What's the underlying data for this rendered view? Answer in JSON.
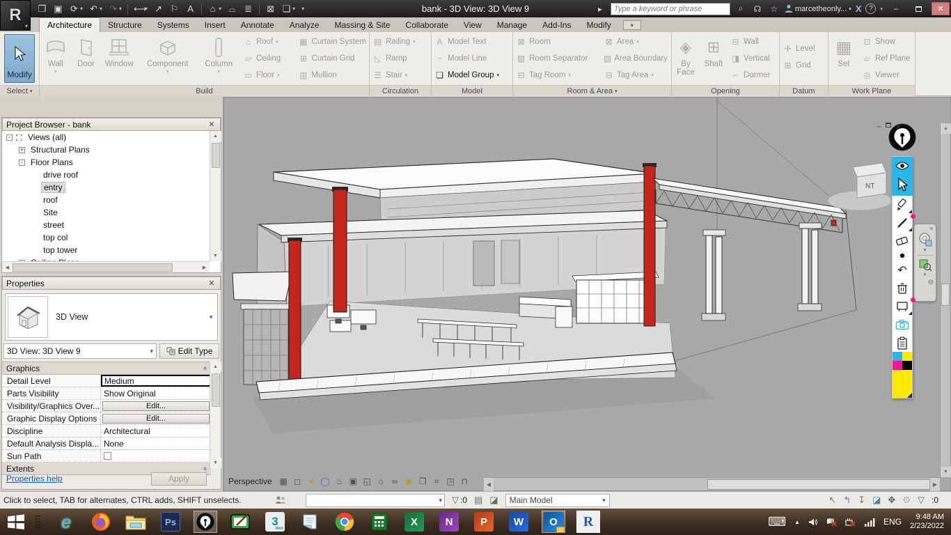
{
  "ui": {
    "caret": "▾",
    "caret_right": "▸",
    "up": "▲",
    "down": "▼",
    "left": "◀",
    "right": "▶",
    "minimize": "–",
    "close": "✕",
    "collapse": "-",
    "expand": "+",
    "section_pin": "«",
    "ellipsis_x": "✕"
  },
  "title_bar": {
    "title": "bank - 3D View: 3D View 9",
    "search_placeholder": "Type a keyword or phrase",
    "account_name": "marcetheonly...",
    "exchange_label": "X",
    "help_label": "?",
    "qat": [
      {
        "name": "open-file-icon",
        "glyph": "❒"
      },
      {
        "name": "save-icon",
        "glyph": "▣"
      },
      {
        "name": "sync-with-central-icon",
        "glyph": "⟳"
      },
      {
        "name": "undo-icon",
        "glyph": "↶"
      },
      {
        "name": "redo-icon",
        "glyph": "↷"
      },
      {
        "name": "measure-icon",
        "glyph": "⟷"
      },
      {
        "name": "aligned-dimension-icon",
        "glyph": "↗"
      },
      {
        "name": "tag-by-category-icon",
        "glyph": "⚐"
      },
      {
        "name": "text-icon",
        "glyph": "A"
      },
      {
        "name": "default-3d-view-icon",
        "glyph": "⌂"
      },
      {
        "name": "section-icon",
        "glyph": "⌓"
      },
      {
        "name": "thin-lines-icon",
        "glyph": "≣"
      },
      {
        "name": "close-hidden-windows-icon",
        "glyph": "⊠"
      },
      {
        "name": "switch-windows-icon",
        "glyph": "❏"
      }
    ]
  },
  "ribbon": {
    "tabs": [
      "Architecture",
      "Structure",
      "Systems",
      "Insert",
      "Annotate",
      "Analyze",
      "Massing & Site",
      "Collaborate",
      "View",
      "Manage",
      "Add-Ins",
      "Modify"
    ],
    "panels": [
      {
        "label": "Select",
        "items": [
          "Modify"
        ]
      },
      {
        "label": "Build",
        "items": [
          "Wall",
          "Door",
          "Window",
          "Component",
          "Column",
          "Roof",
          "Ceiling",
          "Floor",
          "Curtain System",
          "Curtain Grid",
          "Mullion"
        ]
      },
      {
        "label": "Circulation",
        "items": [
          "Railing",
          "Ramp",
          "Stair"
        ]
      },
      {
        "label": "Model",
        "items": [
          "Model Text",
          "Model Line",
          "Model Group"
        ]
      },
      {
        "label": "Room & Area",
        "items": [
          "Room",
          "Room Separator",
          "Tag Room",
          "Area",
          "Area Boundary",
          "Tag Area"
        ]
      },
      {
        "label": "Opening",
        "items": [
          "By Face",
          "Shaft",
          "Wall",
          "Vertical",
          "Dormer"
        ]
      },
      {
        "label": "Datum",
        "items": [
          "Level",
          "Grid"
        ]
      },
      {
        "label": "Work Plane",
        "items": [
          "Set",
          "Show",
          "Ref Plane",
          "Viewer"
        ]
      }
    ],
    "small_icons": {
      "roof": "⌂",
      "ceiling": "▱",
      "floor": "▭",
      "curtain_system": "▦",
      "curtain_grid": "⊞",
      "mullion": "▥",
      "railing": "▤",
      "ramp": "◺",
      "stair": "☰",
      "model_text": "A",
      "model_line": "~",
      "model_group": "❏",
      "room": "⊠",
      "room_separator": "▨",
      "tag_room": "⊟",
      "area": "⊠",
      "area_boundary": "▧",
      "tag_area": "⊟",
      "wall_opening": "⊟",
      "vertical_opening": "◨",
      "dormer": "⌐",
      "level": "✛",
      "grid": "⊞",
      "show": "⊡",
      "ref_plane": "▱",
      "viewer": "◎",
      "by_face": "◈",
      "shaft": "⊞",
      "set": "▦"
    }
  },
  "project_browser": {
    "title": "Project Browser - bank",
    "items": [
      {
        "label": "Views (all)"
      },
      {
        "label": "Structural Plans"
      },
      {
        "label": "Floor Plans"
      },
      {
        "label": "drive roof"
      },
      {
        "label": "entry"
      },
      {
        "label": "roof"
      },
      {
        "label": "Site"
      },
      {
        "label": "street"
      },
      {
        "label": "top col"
      },
      {
        "label": "top tower"
      },
      {
        "label": "Ceiling Plans"
      }
    ]
  },
  "properties": {
    "title": "Properties",
    "type_name": "3D View",
    "selector_value": "3D View: 3D View 9",
    "edit_type_label": "Edit Type",
    "section_graphics": "Graphics",
    "section_extents": "Extents",
    "rows": [
      {
        "label": "Detail Level",
        "value": "Medium"
      },
      {
        "label": "Parts Visibility",
        "value": "Show Original"
      },
      {
        "label": "Visibility/Graphics Over...",
        "value": "Edit..."
      },
      {
        "label": "Graphic Display Options",
        "value": "Edit..."
      },
      {
        "label": "Discipline",
        "value": "Architectural"
      },
      {
        "label": "Default Analysis Displa...",
        "value": "None"
      },
      {
        "label": "Sun Path",
        "value": ""
      }
    ],
    "help_link": "Properties help",
    "apply_label": "Apply"
  },
  "viewport": {
    "perspective_label": "Perspective",
    "view_cube_text": "NT",
    "vcb_icons": [
      {
        "name": "detail-level-icon",
        "glyph": "▦"
      },
      {
        "name": "visual-style-icon",
        "glyph": "◻"
      },
      {
        "name": "sun-path-icon",
        "glyph": "☀"
      },
      {
        "name": "shadows-icon",
        "glyph": "◯"
      },
      {
        "name": "rendering-dialog-icon",
        "glyph": "♨"
      },
      {
        "name": "crop-view-icon",
        "glyph": "▣"
      },
      {
        "name": "show-crop-region-icon",
        "glyph": "◱"
      },
      {
        "name": "lock-3d-view-icon",
        "glyph": "⌂"
      },
      {
        "name": "temporary-hide-isolate-icon",
        "glyph": "∞"
      },
      {
        "name": "reveal-hidden-elements-icon",
        "glyph": "◉"
      },
      {
        "name": "temporary-view-properties-icon",
        "glyph": "❒"
      },
      {
        "name": "show-analytical-model-icon",
        "glyph": "⌗"
      },
      {
        "name": "highlight-displacement-sets-icon",
        "glyph": "◳"
      },
      {
        "name": "reveal-constraints-icon",
        "glyph": "⊓"
      }
    ]
  },
  "status_bar": {
    "hint": "Click to select, TAB for alternates, CTRL adds, SHIFT unselects.",
    "workset_filter_count": ":0",
    "design_option": "Main Model",
    "selection_count": ":0",
    "right_icons": [
      {
        "name": "select-links-icon",
        "glyph": "↖"
      },
      {
        "name": "select-underlay-elements-icon",
        "glyph": "↰"
      },
      {
        "name": "select-pinned-elements-icon",
        "glyph": "↧"
      },
      {
        "name": "select-elements-by-face-icon",
        "glyph": "◪"
      },
      {
        "name": "drag-elements-on-selection-icon",
        "glyph": "✥"
      },
      {
        "name": "gear-icon",
        "glyph": "⚙"
      },
      {
        "name": "selection-filter-icon",
        "glyph": "▽"
      }
    ]
  },
  "taskbar": {
    "apps": [
      {
        "name": "internet-explorer",
        "glyph": "e"
      },
      {
        "name": "photoshop",
        "glyph": "Ps"
      },
      {
        "name": "3ds-max",
        "glyph": "3"
      },
      {
        "name": "3ds-max-sub",
        "glyph": "MAX"
      },
      {
        "name": "excel",
        "glyph": "X"
      },
      {
        "name": "onenote",
        "glyph": "N"
      },
      {
        "name": "powerpoint",
        "glyph": "P"
      },
      {
        "name": "word",
        "glyph": "W"
      },
      {
        "name": "outlook",
        "glyph": "O"
      },
      {
        "name": "revit",
        "glyph": "R"
      }
    ],
    "tray": {
      "language": "ENG",
      "time": "9:48 AM",
      "date": "2/23/2022"
    }
  },
  "colors": {
    "selection_accent_blue": "#7fa9cb",
    "section_cut_red": "#c5271c",
    "viewport_background": "#a6a8aa",
    "epic_pen_cyan": "#29b6e8",
    "epic_pen_magenta": "#ff1493",
    "epic_pen_yellow": "#ffe900",
    "taskbar_brown": "#3b2c20"
  }
}
